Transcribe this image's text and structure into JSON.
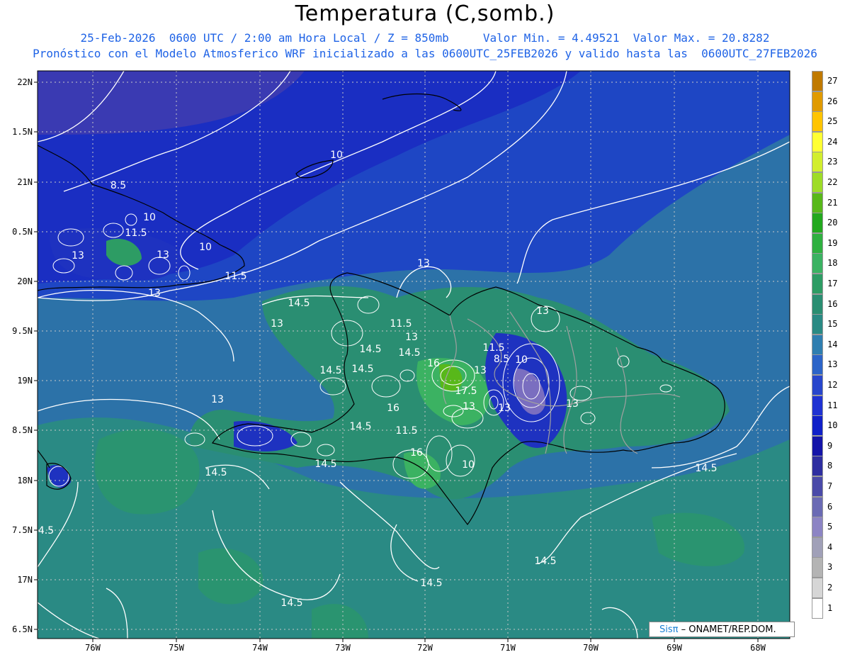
{
  "header": {
    "title": "Temperatura (C,somb.)",
    "subtitle_line1": "25-Feb-2026  0600 UTC / 2:00 am Hora Local / Z = 850mb     Valor Min. = 4.49521  Valor Max. = 20.8282",
    "subtitle_line2": "Pronóstico con el Modelo Atmosferico WRF inicializado a las 0600UTC_25FEB2026 y valido hasta las  0600UTC_27FEB2026"
  },
  "axes": {
    "lon_labels": [
      "76W",
      "75W",
      "74W",
      "73W",
      "72W",
      "71W",
      "70W",
      "69W",
      "68W"
    ],
    "lat_labels": [
      "22N",
      "1.5N",
      "21N",
      "0.5N",
      "20N",
      "9.5N",
      "19N",
      "8.5N",
      "18N",
      "7.5N",
      "17N",
      "6.5N"
    ]
  },
  "contour_labels": [
    "10",
    "8.5",
    "10",
    "11.5",
    "13",
    "13",
    "10",
    "11.5",
    "13",
    "13",
    "14.5",
    "13",
    "11.5",
    "13",
    "13",
    "14.5",
    "14.5",
    "14.5",
    "11.5",
    "8.5",
    "10",
    "16",
    "13",
    "17.5",
    "13",
    "13",
    "14.5",
    "11.5",
    "16",
    "10",
    "13",
    "14.5",
    "14.5",
    "14.5",
    "14.5",
    "14.5",
    "14.5",
    "14.5",
    "4.5",
    "16",
    "13"
  ],
  "colorbar": {
    "labels": [
      "27",
      "26",
      "25",
      "24",
      "23",
      "22",
      "21",
      "20",
      "19",
      "18",
      "17",
      "16",
      "15",
      "14",
      "13",
      "12",
      "11",
      "10",
      "9",
      "8",
      "7",
      "6",
      "5",
      "4",
      "3",
      "2",
      "1"
    ],
    "colors": [
      "#c07a00",
      "#e09a00",
      "#ffc400",
      "#ffff33",
      "#d2ee2e",
      "#9edc28",
      "#58b81a",
      "#22a81e",
      "#2fb040",
      "#3bb262",
      "#2d9c64",
      "#2a8e72",
      "#2a8a84",
      "#2f7eb0",
      "#2c64c8",
      "#2846cc",
      "#1f32d2",
      "#1020c8",
      "#1414a8",
      "#2e2ea0",
      "#4a4aa8",
      "#6a6ab4",
      "#8c84c4",
      "#a0a0b8",
      "#b4b4b4",
      "#d6d6d6",
      "#ffffff"
    ]
  },
  "credit": {
    "logo": "Sisπ",
    "text": " – ONAMET/REP.DOM."
  }
}
